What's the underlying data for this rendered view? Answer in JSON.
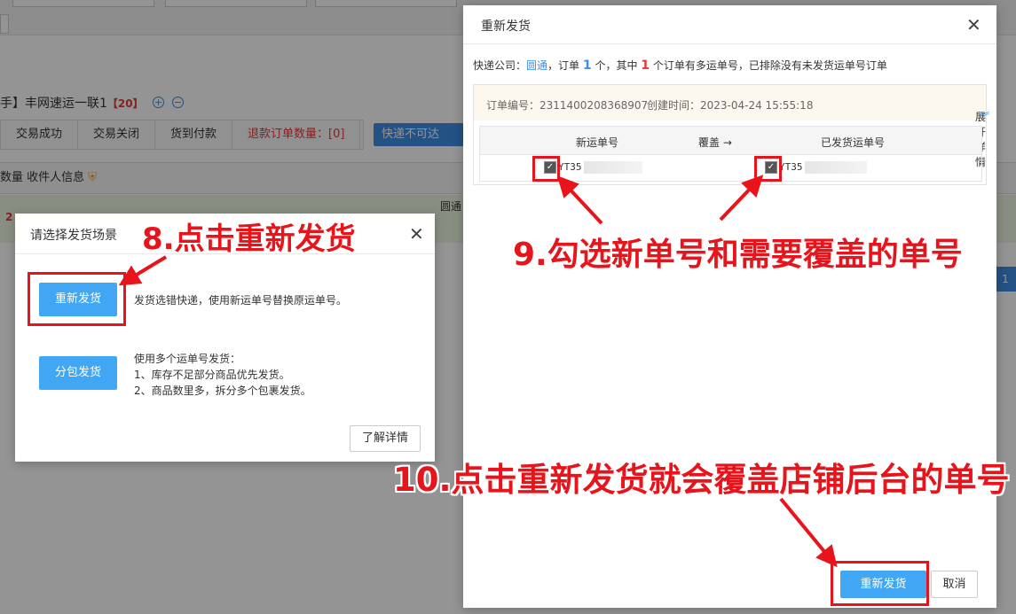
{
  "background": {
    "title_prefix": "手】丰网速运一联1",
    "title_count": "【20】",
    "tabs": [
      {
        "label": "交易成功"
      },
      {
        "label": "交易关闭"
      },
      {
        "label": "货到付款"
      },
      {
        "label": "退款订单数量：[0]"
      }
    ],
    "dropdown_label": "快递不可达",
    "header_text": "数量 收件人信息",
    "row_number": "2",
    "row_carrier": "圆通",
    "side_number": "1"
  },
  "scene_dialog": {
    "title": "请选择发货场景",
    "reship_button": "重新发货",
    "reship_desc": "发货选错快递，使用新运单号替换原运单号。",
    "split_button": "分包发货",
    "split_desc_lines": [
      "使用多个运单号发货：",
      "1、库存不足部分商品优先发货。",
      "2、商品数里多，拆分多个包裹发货。"
    ],
    "learn_more_button": "了解详情"
  },
  "reship_dialog": {
    "title": "重新发货",
    "info": {
      "courier_prefix": "快递公司：",
      "courier_name": "圆通",
      "orders_prefix": "，订单",
      "order_count": "1",
      "orders_mid": "个，其中",
      "multi_count": "1",
      "orders_suffix": "个订单有多运单号，已排除没有未发货运单号订单"
    },
    "order": {
      "number_label": "订单编号：2311400208368907",
      "created_label": "创建时间：2023-04-24 15:55:18",
      "expand_label": "展开详情"
    },
    "grid": {
      "col_new": "新运单号",
      "col_cover": "覆盖 →",
      "col_shipped": "已发货运单号",
      "new_tracking": "YT35",
      "shipped_tracking": "YT35"
    },
    "confirm_button": "重新发货",
    "cancel_button": "取消"
  },
  "annotations": {
    "step8": "8.点击重新发货",
    "step9": "9.勾选新单号和需要覆盖的单号",
    "step10": "10.点击重新发货就会覆盖店铺后台的单号"
  },
  "colors": {
    "annotation_red": "#e8141b",
    "button_blue": "#41a7f5",
    "link_blue": "#3a8ee6"
  }
}
